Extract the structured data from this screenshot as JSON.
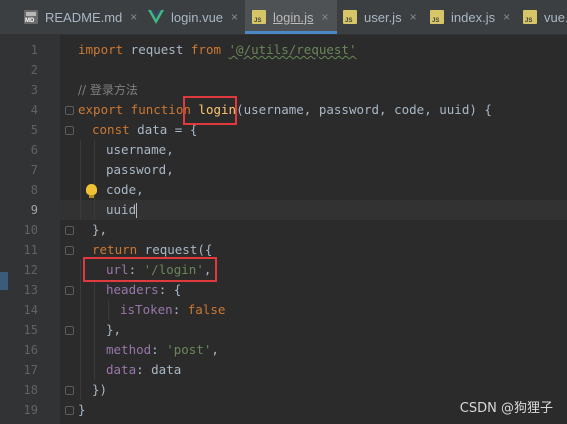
{
  "tabs": [
    {
      "label": "README.md",
      "icon": "markdown-file-icon",
      "active": false
    },
    {
      "label": "login.vue",
      "icon": "vue-file-icon",
      "active": false
    },
    {
      "label": "login.js",
      "icon": "js-file-icon",
      "active": true
    },
    {
      "label": "user.js",
      "icon": "js-file-icon",
      "active": false
    },
    {
      "label": "index.js",
      "icon": "js-file-icon",
      "active": false
    },
    {
      "label": "vue.c",
      "icon": "js-file-icon",
      "active": false
    }
  ],
  "close_glyph": "×",
  "line_numbers": [
    "1",
    "2",
    "3",
    "4",
    "5",
    "6",
    "7",
    "8",
    "9",
    "10",
    "11",
    "12",
    "13",
    "14",
    "15",
    "16",
    "17",
    "18",
    "19"
  ],
  "current_line": "9",
  "code": {
    "l1": {
      "kw": "import",
      "ident": " request ",
      "kw2": "from",
      "sp": " ",
      "str": "'@/utils/request'"
    },
    "l3": "// 登录方法",
    "l4": {
      "kw": "export function ",
      "fn": "login",
      "params": "(username, password, code, uuid) {"
    },
    "l5": {
      "kw": "const",
      "rest": " data = {"
    },
    "l6": "username,",
    "l7": "password,",
    "l8": "code,",
    "l9": "uuid",
    "l10": "},",
    "l11": {
      "kw": "return",
      "rest": " request({"
    },
    "l12": {
      "prop": "url",
      "colon": ": ",
      "str": "'/login'",
      "end": ","
    },
    "l13": {
      "prop": "headers",
      "rest": ": {"
    },
    "l14": {
      "prop": "isToken",
      "colon": ": ",
      "kw": "false"
    },
    "l15": "},",
    "l16": {
      "prop": "method",
      "colon": ": ",
      "str": "'post'",
      "end": ","
    },
    "l17": {
      "prop": "data",
      "rest": ": data"
    },
    "l18": "})",
    "l19": "}"
  },
  "watermark": "CSDN @狗狸子",
  "colors": {
    "highlight_box": "#e0393e",
    "keyword": "#cc7832",
    "string": "#6a8759",
    "function": "#ffc66d",
    "property": "#9876aa"
  }
}
